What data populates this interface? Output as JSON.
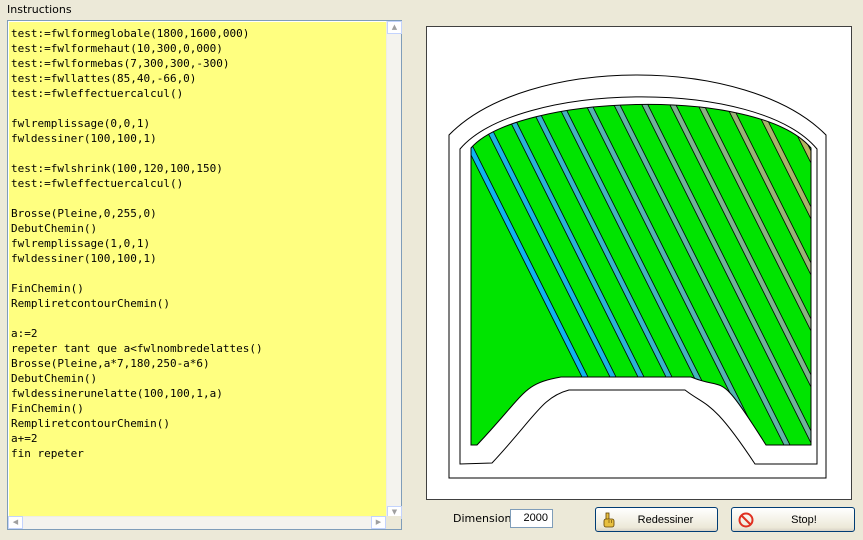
{
  "panel": {
    "title": "Instructions"
  },
  "code_lines": [
    "test:=fwlformeglobale(1800,1600,000)",
    "test:=fwlformehaut(10,300,0,000)",
    "test:=fwlformebas(7,300,300,-300)",
    "test:=fwllattes(85,40,-66,0)",
    "test:=fwleffectuercalcul()",
    "",
    "fwlremplissage(0,0,1)",
    "fwldessiner(100,100,1)",
    "",
    "test:=fwlshrink(100,120,100,150)",
    "test:=fwleffectuercalcul()",
    "",
    "Brosse(Pleine,0,255,0)",
    "DebutChemin()",
    "fwlremplissage(1,0,1)",
    "fwldessiner(100,100,1)",
    "",
    "FinChemin()",
    "RempliretcontourChemin()",
    "",
    "a:=2",
    "repeter tant que a<fwlnombredelattes()",
    "Brosse(Pleine,a*7,180,250-a*6)",
    "DebutChemin()",
    "fwldessinerunelatte(100,100,1,a)",
    "FinChemin()",
    "RempliretcontourChemin()",
    "a+=2",
    "fin repeter"
  ],
  "controls": {
    "dimension_label": "Dimension",
    "dimension_value": "2000",
    "redraw_label": "Redessiner",
    "stop_label": "Stop!"
  },
  "icons": {
    "redraw": "hand-pointer-icon",
    "stop": "stop-sign-icon"
  },
  "colors": {
    "editor_bg": "#ffff80",
    "fill_green": "#00e400",
    "stop_red": "#e03020"
  },
  "drawing": {
    "slat_count": 20,
    "base_fill_rgb": [
      0,
      255,
      0
    ],
    "slat_brush_formula": "Brosse(Pleine,a*7,180,250-a*6)"
  }
}
